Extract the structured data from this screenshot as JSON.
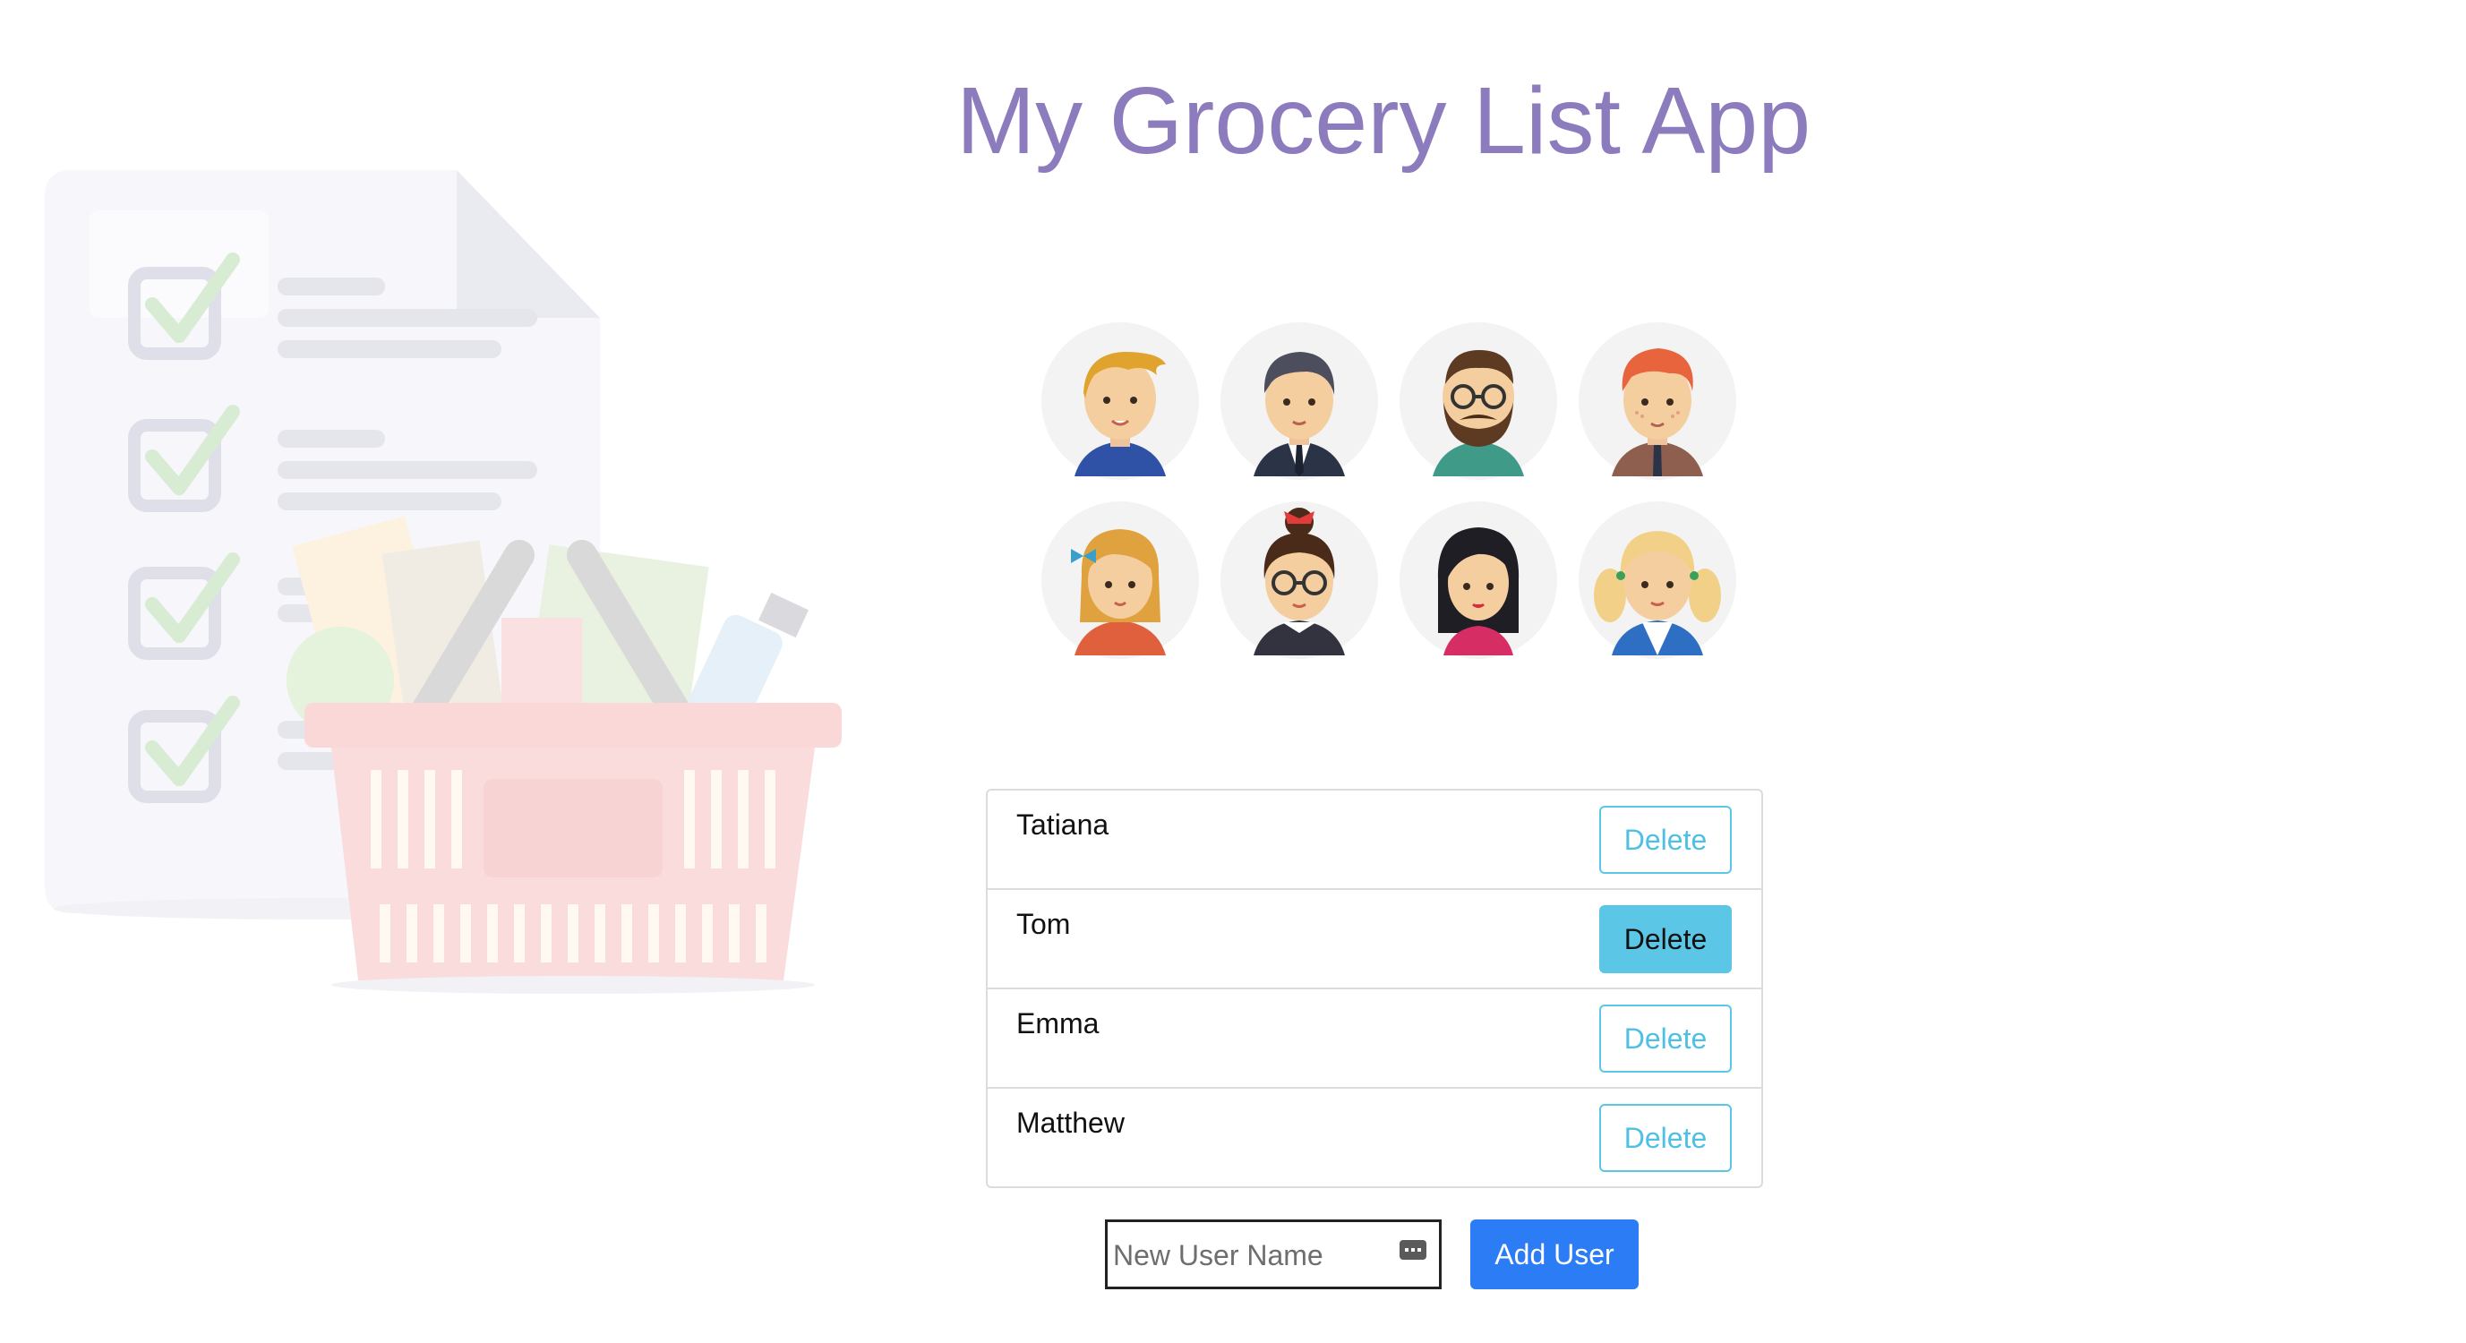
{
  "app": {
    "title": "My Grocery List App"
  },
  "avatars": [
    {
      "name": "avatar-boy-blonde"
    },
    {
      "name": "avatar-man-suit"
    },
    {
      "name": "avatar-man-beard-glasses"
    },
    {
      "name": "avatar-man-redhead"
    },
    {
      "name": "avatar-girl-bow"
    },
    {
      "name": "avatar-woman-glasses-bun"
    },
    {
      "name": "avatar-woman-black-hair"
    },
    {
      "name": "avatar-girl-pigtails"
    }
  ],
  "users": [
    {
      "name": "Tatiana",
      "delete_label": "Delete"
    },
    {
      "name": "Tom",
      "delete_label": "Delete"
    },
    {
      "name": "Emma",
      "delete_label": "Delete"
    },
    {
      "name": "Matthew",
      "delete_label": "Delete"
    }
  ],
  "add_user": {
    "placeholder": "New User Name",
    "value": "",
    "button_label": "Add User"
  },
  "colors": {
    "title": "#8c7bbd",
    "delete_outline": "#5bc6e6",
    "add_button": "#2c7cf6"
  }
}
